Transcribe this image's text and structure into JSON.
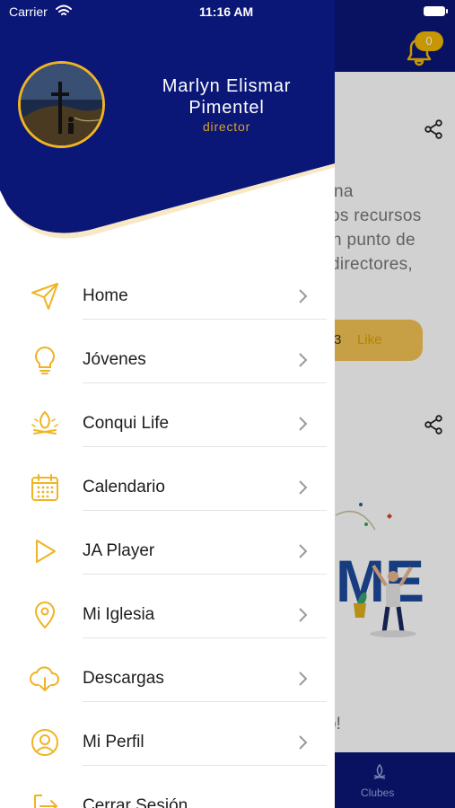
{
  "status_bar": {
    "carrier": "Carrier",
    "time": "11:16 AM"
  },
  "background": {
    "notification_count": "0",
    "text_lines": [
      "na",
      "os recursos",
      "n punto de",
      "directores,"
    ],
    "like_count": "3",
    "like_label": "Like",
    "partial_text_end": "o!",
    "illustration_text": "ME",
    "tab_label": "Clubes"
  },
  "drawer": {
    "user": {
      "name_line1": "Marlyn Elismar",
      "name_line2": "Pimentel",
      "role": "director"
    },
    "menu": [
      {
        "label": "Home",
        "icon": "send-icon"
      },
      {
        "label": "Jóvenes",
        "icon": "lightbulb-icon"
      },
      {
        "label": "Conqui Life",
        "icon": "campfire-icon"
      },
      {
        "label": "Calendario",
        "icon": "calendar-icon"
      },
      {
        "label": "JA Player",
        "icon": "play-icon"
      },
      {
        "label": "Mi Iglesia",
        "icon": "location-pin-icon"
      },
      {
        "label": "Descargas",
        "icon": "cloud-download-icon"
      },
      {
        "label": "Mi Perfil",
        "icon": "user-circle-icon"
      },
      {
        "label": "Cerrar Sesión",
        "icon": "logout-icon"
      }
    ]
  },
  "colors": {
    "primary_navy": "#0a1777",
    "accent_gold": "#f0b323",
    "divider": "#e4e4e4"
  }
}
